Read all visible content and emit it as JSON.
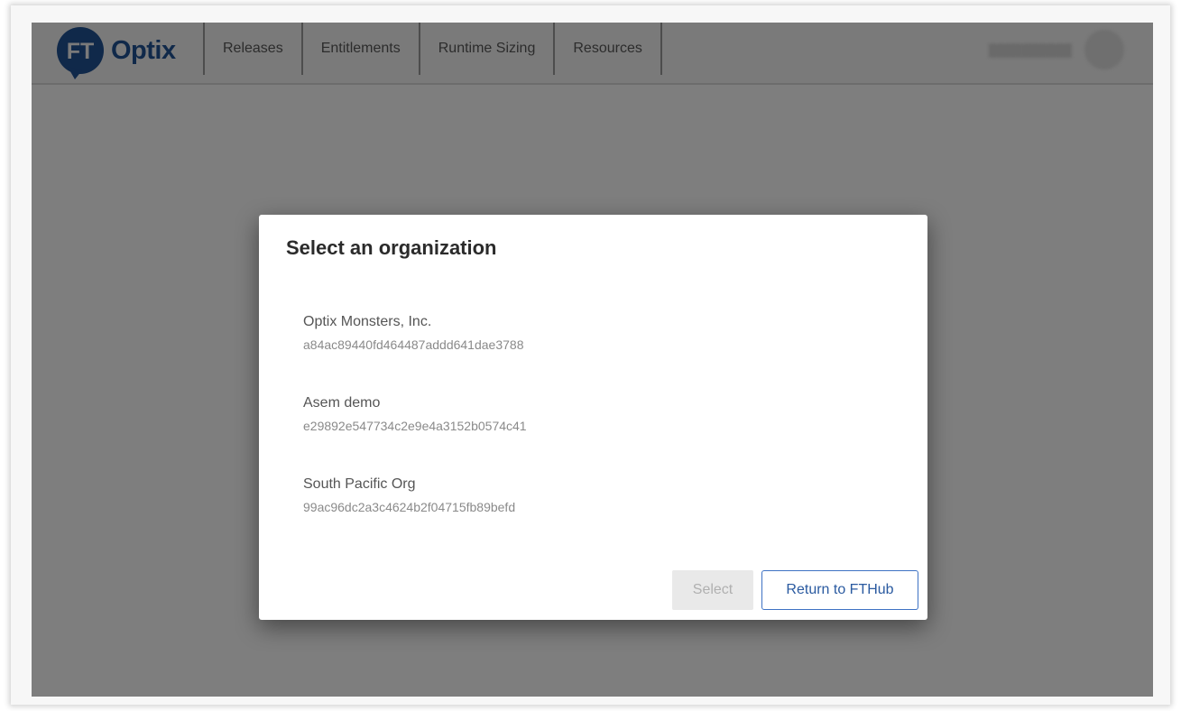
{
  "brand": {
    "mark_text": "FT",
    "name": "Optix",
    "color": "#10294a"
  },
  "nav": {
    "items": [
      {
        "label": "Releases"
      },
      {
        "label": "Entitlements"
      },
      {
        "label": "Runtime Sizing"
      },
      {
        "label": "Resources"
      }
    ]
  },
  "user": {
    "name_obscured": true
  },
  "modal": {
    "title": "Select an organization",
    "organizations": [
      {
        "name": "Optix Monsters, Inc.",
        "id": "a84ac89440fd464487addd641dae3788"
      },
      {
        "name": "Asem demo",
        "id": "e29892e547734c2e9e4a3152b0574c41"
      },
      {
        "name": "South Pacific Org",
        "id": "99ac96dc2a3c4624b2f04715fb89befd"
      }
    ],
    "select_label": "Select",
    "select_enabled": false,
    "return_label": "Return to FTHub"
  },
  "colors": {
    "overlay": "#7e7e7e",
    "accent": "#3e72c4",
    "disabled_bg": "#e9e9e9"
  }
}
